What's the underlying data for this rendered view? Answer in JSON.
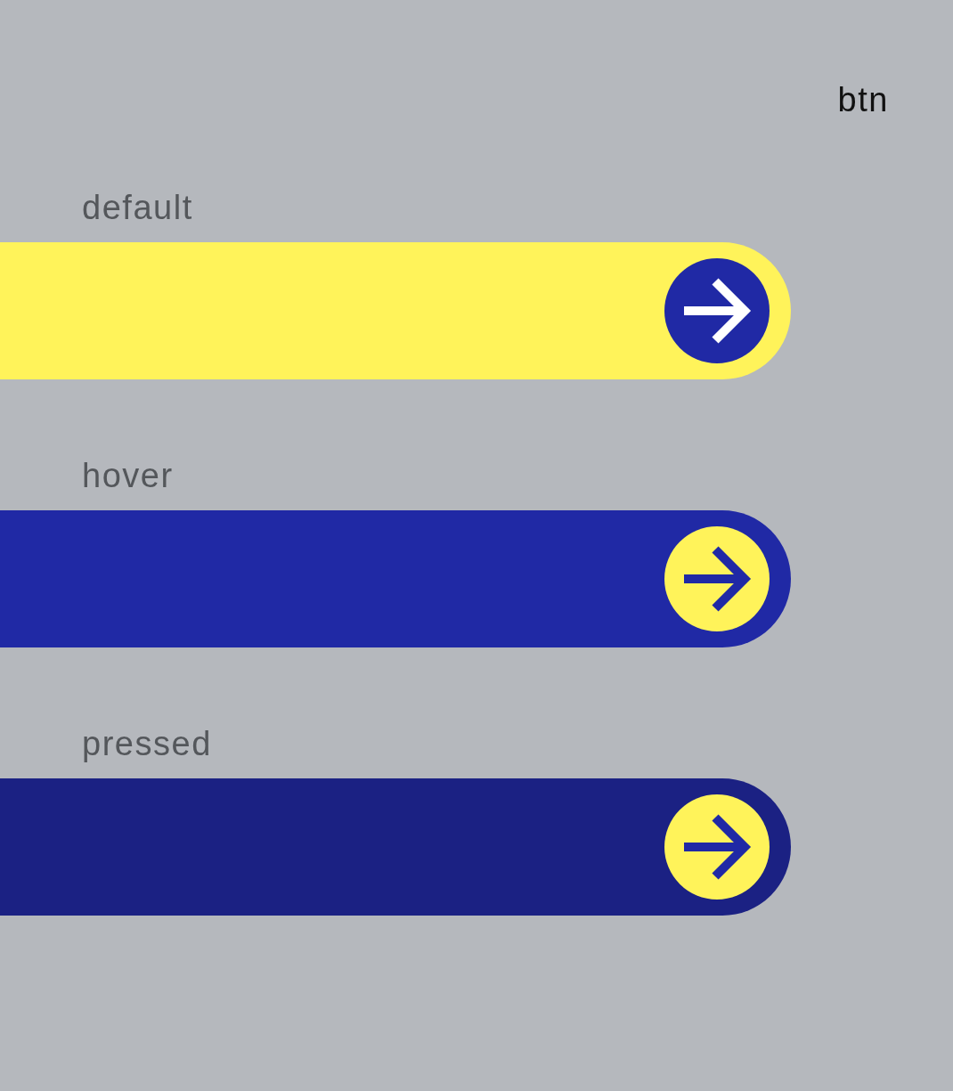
{
  "title": "btn",
  "states": [
    {
      "kind": "default",
      "label": "default"
    },
    {
      "kind": "hover",
      "label": "hover"
    },
    {
      "kind": "pressed",
      "label": "pressed"
    }
  ]
}
